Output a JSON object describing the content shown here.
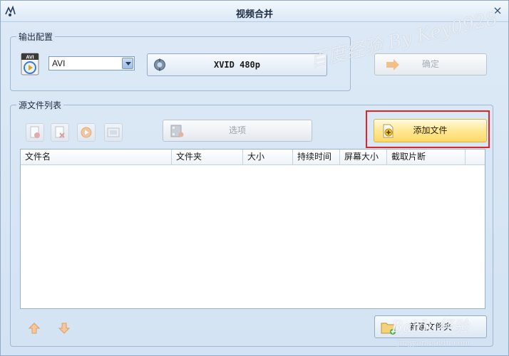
{
  "window": {
    "title": "视频合并",
    "close_glyph": "×"
  },
  "output_group": {
    "label": "输出配置",
    "format_value": "AVI",
    "format_icon_text": "AVI",
    "preset_label": "XVID 480p",
    "ok_label": "确定"
  },
  "source_group": {
    "label": "源文件列表",
    "options_label": "选项",
    "add_file_label": "添加文件",
    "columns": [
      "文件名",
      "文件夹",
      "大小",
      "持续时间",
      "屏幕大小",
      "截取片断"
    ],
    "new_folder_label": "新建文件夹"
  },
  "colors": {
    "highlight": "#e42525",
    "add_button": "#ffe99a",
    "window_bg": "#d6e6f5"
  },
  "watermark": {
    "text": "百度经验 By Key0928",
    "corner_text": "Baidu经验",
    "corner_sub": "jingyan.baidu.com"
  }
}
